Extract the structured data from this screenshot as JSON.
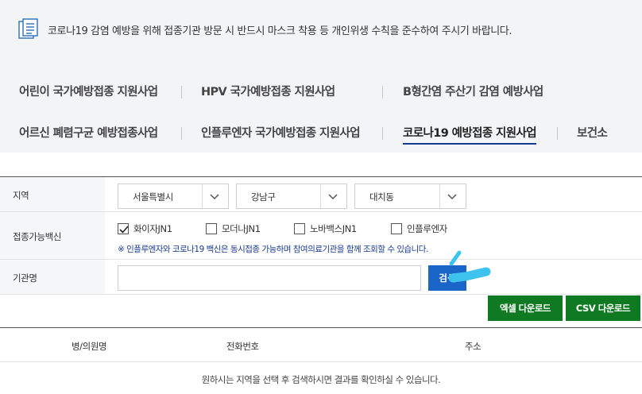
{
  "notice": {
    "text": "코로나19 감염 예방을 위해 접종기관 방문 시 반드시 마스크 착용 등 개인위생 수칙을 준수하여 주시기 바랍니다."
  },
  "tabs": {
    "row1": [
      "어린이 국가예방접종 지원사업",
      "HPV 국가예방접종 지원사업",
      "B형간염 주산기 감염 예방사업"
    ],
    "row2": [
      "어르신 폐렴구균 예방접종사업",
      "인플루엔자 국가예방접종 지원사업",
      "코로나19 예방접종 지원사업",
      "보건소"
    ],
    "active": "코로나19 예방접종 지원사업"
  },
  "form": {
    "region_label": "지역",
    "region": {
      "sido": "서울특별시",
      "sigungu": "강남구",
      "dong": "대치동"
    },
    "vaccine_label": "접종가능백신",
    "vaccines": [
      {
        "label": "화이자JN1",
        "checked": true
      },
      {
        "label": "모더나JN1",
        "checked": false
      },
      {
        "label": "노바백스JN1",
        "checked": false
      },
      {
        "label": "인플루엔자",
        "checked": false
      }
    ],
    "vaccine_note": "※ 인플루엔자와 코로나19 백신은 동시접종 가능하며 참여의료기관을 함께 조회할 수 있습니다.",
    "org_label": "기관명",
    "org_value": "",
    "search_label": "검색"
  },
  "downloads": {
    "excel_label": "엑셀 다운로드",
    "csv_label": "CSV 다운로드"
  },
  "results": {
    "columns": [
      "병/의원명",
      "전화번호",
      "주소"
    ],
    "empty_message": "원하시는 지역을 선택 후 검색하시면 결과를 확인하실 수 있습니다."
  },
  "colors": {
    "accent_blue": "#1a66c8",
    "download_green": "#0f7a22",
    "highlight": "#3ec3ee",
    "active_underline": "#1a3a8f"
  }
}
